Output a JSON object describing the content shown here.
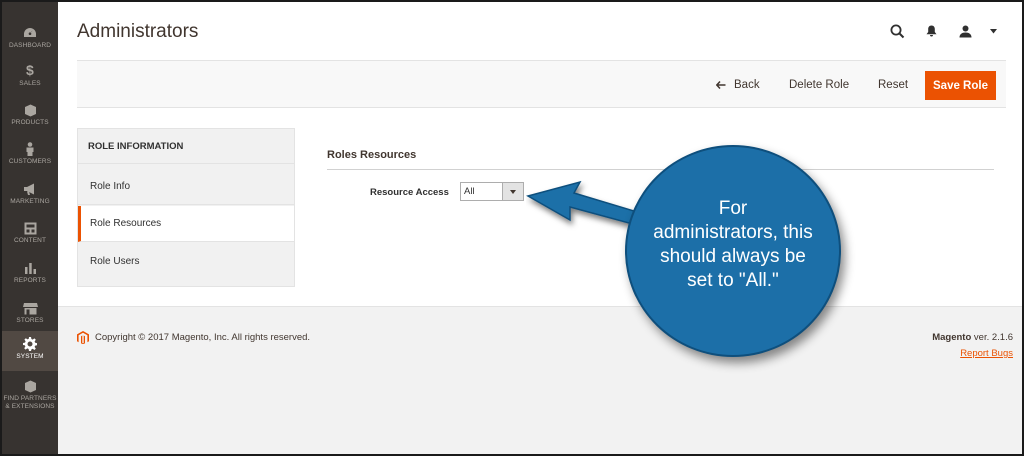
{
  "sidebar": {
    "items": [
      {
        "label": "DASHBOARD",
        "icon": "dashboard-icon"
      },
      {
        "label": "SALES",
        "icon": "dollar-icon"
      },
      {
        "label": "PRODUCTS",
        "icon": "box-icon"
      },
      {
        "label": "CUSTOMERS",
        "icon": "person-icon"
      },
      {
        "label": "MARKETING",
        "icon": "megaphone-icon"
      },
      {
        "label": "CONTENT",
        "icon": "layout-icon"
      },
      {
        "label": "REPORTS",
        "icon": "bar-chart-icon"
      },
      {
        "label": "STORES",
        "icon": "storefront-icon"
      },
      {
        "label": "SYSTEM",
        "icon": "gear-icon",
        "active": true
      },
      {
        "label_line1": "FIND PARTNERS",
        "label_line2": "& EXTENSIONS",
        "icon": "cube-icon"
      }
    ]
  },
  "header": {
    "title": "Administrators",
    "icons": [
      "search-icon",
      "bell-icon",
      "user-icon",
      "dropdown-caret-icon"
    ]
  },
  "actions": {
    "back": "Back",
    "delete_role": "Delete Role",
    "reset": "Reset",
    "save_role": "Save Role"
  },
  "tabs": {
    "title": "ROLE INFORMATION",
    "items": [
      {
        "label": "Role Info"
      },
      {
        "label": "Role Resources",
        "active": true
      },
      {
        "label": "Role Users"
      }
    ]
  },
  "content": {
    "section_title": "Roles Resources",
    "resource_access_label": "Resource Access",
    "resource_access_value": "All"
  },
  "footer": {
    "copyright": "Copyright © 2017 Magento, Inc. All rights reserved.",
    "brand": "Magento",
    "version": "ver. 2.1.6",
    "report_bugs": "Report Bugs"
  },
  "callout": {
    "line1": "For",
    "line2": "administrators, this",
    "line3": "should always be",
    "line4": "set to \"All.\""
  },
  "colors": {
    "accent": "#eb5202",
    "sidebar_bg": "#373330",
    "callout_blue": "#1c6fa8"
  }
}
